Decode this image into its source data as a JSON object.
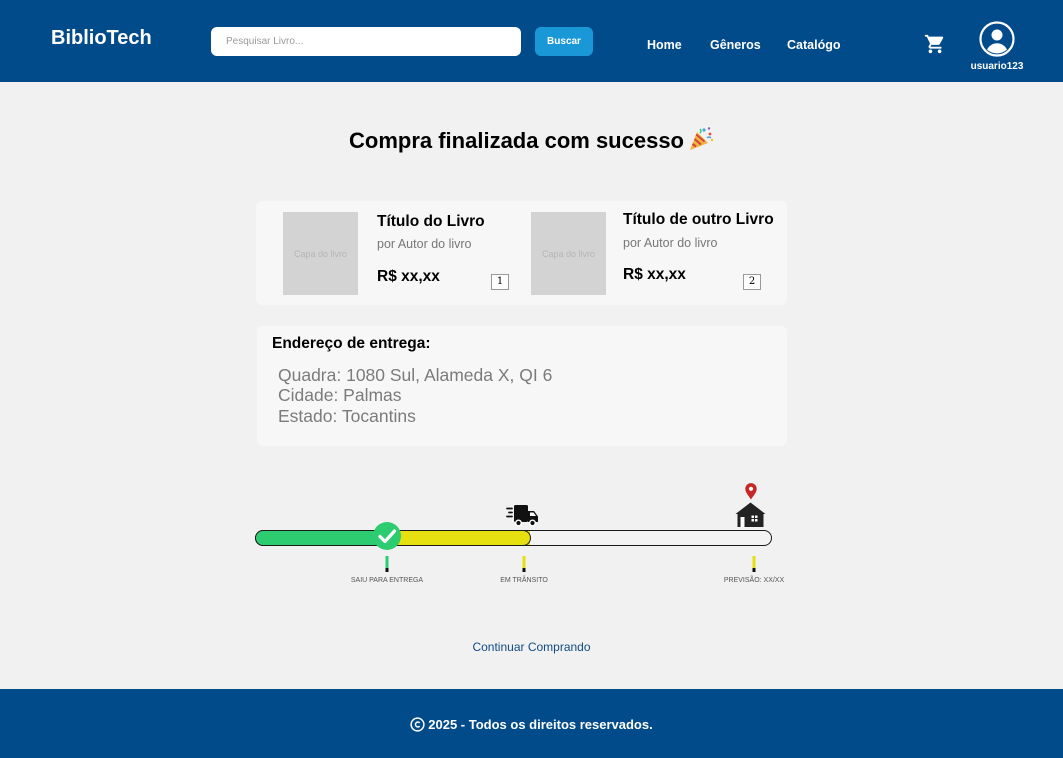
{
  "header": {
    "logo": "BiblioTech",
    "search_placeholder": "Pesquisar Livro...",
    "search_button": "Buscar",
    "nav": [
      "Home",
      "Gêneros",
      "Catalógo"
    ],
    "username": "usuario123",
    "icons": {
      "cart": "cart-icon",
      "user": "user-avatar-icon"
    }
  },
  "main": {
    "title": "Compra finalizada com sucesso",
    "title_icon": "party-popper-icon",
    "books": [
      {
        "cover_label": "Capa do livro",
        "title": "Título do Livro",
        "author": "por Autor do livro",
        "price": "R$ xx,xx",
        "quantity": "1"
      },
      {
        "cover_label": "Capa do livro",
        "title": "Título de outro Livro",
        "author": "por Autor do livro",
        "price": "R$ xx,xx",
        "quantity": "2"
      }
    ],
    "address": {
      "heading": "Endereço de entrega:",
      "lines": [
        "Quadra: 1080 Sul, Alameda X, QI 6",
        "Cidade: Palmas",
        "Estado: Tocantins"
      ]
    },
    "tracker": {
      "stages": [
        "SAIU PARA ENTREGA",
        "EM TRÂNSITO",
        "PREVISÃO: XX/XX"
      ],
      "icons": [
        "check-icon",
        "delivery-truck-icon",
        "location-pin-icon",
        "house-icon"
      ],
      "colors": {
        "completed": "#2ecc71",
        "in_progress": "#e6e010",
        "pending": "#f3f3f3",
        "pin": "#c62828"
      }
    },
    "continue_link": "Continuar Comprando"
  },
  "footer": {
    "text": "2025 - Todos os direitos reservados.",
    "icon": "copyright-icon"
  },
  "colors": {
    "header_bg": "#024b8a",
    "search_button_bg": "#1a97d6",
    "page_bg": "#f1f1f1"
  }
}
